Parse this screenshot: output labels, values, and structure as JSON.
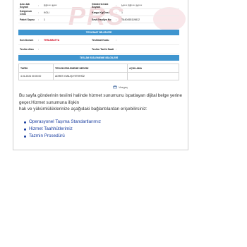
{
  "watermark": "PRS",
  "rows_top": [
    {
      "l1": "Alıcı Adı Soyadı",
      "v1": "RE**** M***",
      "l2": "Gönderici Adı Soyadı",
      "v2": "N**** RE**** AY***"
    },
    {
      "l1": "Kargonun Cinsi",
      "v1": "KOLI",
      "l2": "Kargo Kg/Desi",
      "v2": "1"
    },
    {
      "l1": "Paket Sayısı",
      "v1": "1",
      "l2": "Sevk İrsaliye No",
      "v2": "TA40455119812"
    }
  ],
  "section1_title": "TESLİMAT BİLGİLERİ",
  "rows_delivery": [
    {
      "l1": "Son Durum",
      "v1": "TESLİMATTA",
      "l2": "Teslimat Kodu",
      "v2": ""
    },
    {
      "l1": "Teslim Alan",
      "v1": "",
      "l2": "Teslim Tarihi Saati",
      "v2": ""
    }
  ],
  "section2_title": "TESLİM EDİLEMEME BİLGİLERİ",
  "table": {
    "headers": [
      "TARİH",
      "TESLİM EDİLEMEME NEDENİ",
      "AÇIKLAMA"
    ],
    "rows": [
      [
        "4.01.2024 00:00:00",
        "ADRES YANLIŞ/YETERSİZ",
        ""
      ]
    ]
  },
  "vazgec_label": "Vazgeç",
  "description": {
    "line1": "Bu sayfa gönderinin teslimi halinde hizmet sunumunu ispatlayan dijital belge yerine",
    "line2": "geçer.Hizmet sunumuna ilişkin",
    "line3": "hak ve yükümlülüklerinize aşağıdaki bağlantılardan erişebilirsiniz:"
  },
  "links": [
    "Operasyonel Taşıma Standartlarımız",
    "Hizmet Taahhütlerimiz",
    "Tazmin Prosedürü"
  ],
  "colors": {
    "accent": "#3f95cf",
    "alert": "#d0021b",
    "link": "#1a3ea0"
  }
}
